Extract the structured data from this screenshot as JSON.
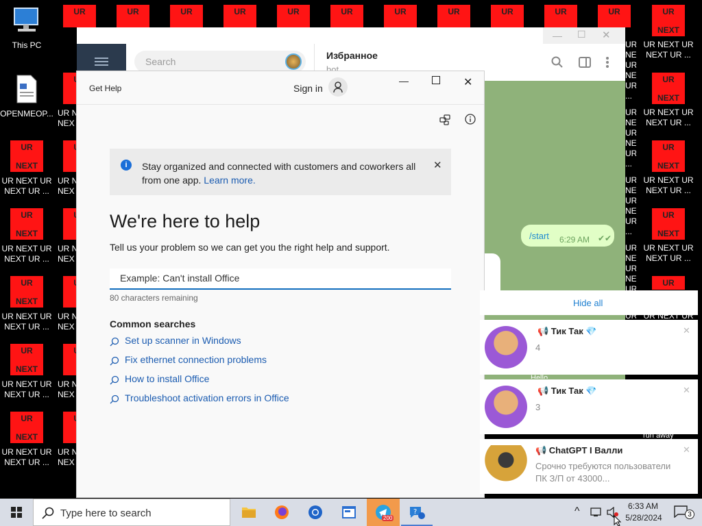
{
  "desktop": {
    "this_pc": "This PC",
    "openmeop": "OPENMEOP...",
    "ur_top": "UR",
    "ur_bottom": "NEXT",
    "ur_label_line1": "UR NEXT UR",
    "ur_label_line2": "NEXT UR ...",
    "ur_partial_line1": "UR N",
    "ur_partial_line2": "NEX"
  },
  "telegram": {
    "search_placeholder": "Search",
    "chat_title": "Избранное",
    "chat_subtitle": "bot",
    "msg_text": "/start",
    "msg_time": "6:29 AM",
    "bg_hello": "Hello",
    "bg_run_away": "run away"
  },
  "get_help": {
    "title": "Get Help",
    "sign_in": "Sign in",
    "banner_text": "Stay organized and connected with customers and coworkers all from one app.",
    "banner_link": "Learn more.",
    "heading": "We're here to help",
    "subheading": "Tell us your problem so we can get you the right help and support.",
    "input_placeholder": "Example: Can't install Office",
    "char_count": "80 characters remaining",
    "common_title": "Common searches",
    "common": [
      "Set up scanner in Windows",
      "Fix ethernet connection problems",
      "How to install Office",
      "Troubleshoot activation errors in Office"
    ]
  },
  "notifications": {
    "hide_all": "Hide all",
    "items": [
      {
        "title": "📢 Тик Так 💎",
        "body": "4"
      },
      {
        "title": "📢 Тик Так 💎",
        "body": "3"
      },
      {
        "title": "📢 ChatGPT I Валли",
        "body": "Срочно требуются пользователи ПК З/П от 43000..."
      }
    ]
  },
  "taskbar": {
    "search_placeholder": "Type here to search",
    "telegram_badge": "200",
    "time": "6:33 AM",
    "date": "5/28/2024",
    "notif_count": "3"
  },
  "colors": {
    "ur_red": "#ff1414",
    "tg_green": "#8fb27a",
    "link_blue": "#1a5bb0",
    "taskbar": "#d9dde6"
  }
}
